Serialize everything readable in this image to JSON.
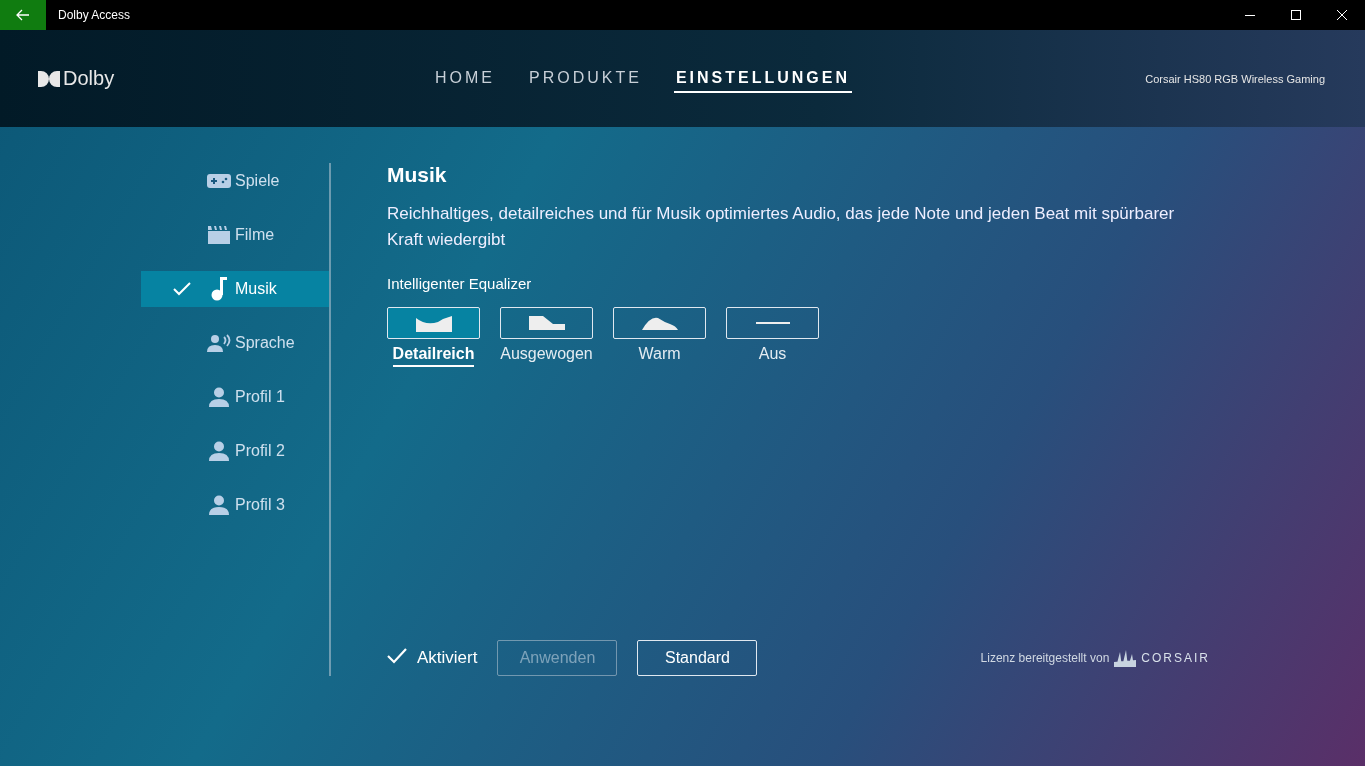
{
  "window": {
    "title": "Dolby Access"
  },
  "header": {
    "logo": "Dolby",
    "device": "Corsair HS80 RGB Wireless Gaming"
  },
  "nav": [
    {
      "label": "HOME",
      "selected": false
    },
    {
      "label": "PRODUKTE",
      "selected": false
    },
    {
      "label": "EINSTELLUNGEN",
      "selected": true
    }
  ],
  "sidebar": {
    "items": [
      {
        "label": "Spiele",
        "selected": false
      },
      {
        "label": "Filme",
        "selected": false
      },
      {
        "label": "Musik",
        "selected": true
      },
      {
        "label": "Sprache",
        "selected": false
      },
      {
        "label": "Profil 1",
        "selected": false
      },
      {
        "label": "Profil 2",
        "selected": false
      },
      {
        "label": "Profil 3",
        "selected": false
      }
    ]
  },
  "content": {
    "title": "Musik",
    "description": "Reichhaltiges, detailreiches und für Musik optimiertes Audio, das jede Note und jeden Beat mit spürbarer Kraft wiedergibt",
    "equalizer_label": "Intelligenter Equalizer",
    "presets": [
      {
        "label": "Detailreich",
        "selected": true
      },
      {
        "label": "Ausgewogen",
        "selected": false
      },
      {
        "label": "Warm",
        "selected": false
      },
      {
        "label": "Aus",
        "selected": false
      }
    ]
  },
  "footer": {
    "activated": {
      "label": "Aktiviert",
      "checked": true
    },
    "buttons": [
      {
        "label": "Anwenden",
        "disabled": true
      },
      {
        "label": "Standard",
        "disabled": false
      }
    ],
    "license": "Lizenz bereitgestellt von",
    "brand": "CORSAIR"
  }
}
